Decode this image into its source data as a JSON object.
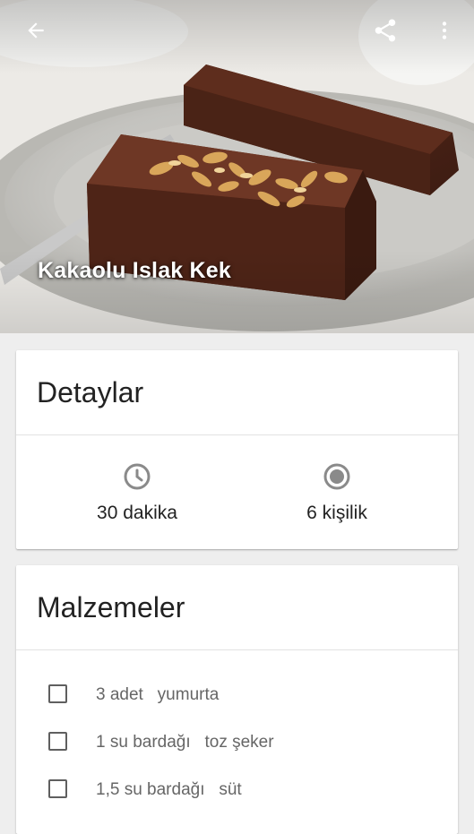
{
  "hero": {
    "title": "Kakaolu Islak Kek"
  },
  "appbar": {
    "icons": [
      "arrow-back-icon",
      "share-icon",
      "more-vert-icon"
    ]
  },
  "details": {
    "title": "Detaylar",
    "time": "30 dakika",
    "servings": "6 kişilik",
    "icons": [
      "clock-icon",
      "servings-icon"
    ]
  },
  "ingredients": {
    "title": "Malzemeler",
    "items": [
      {
        "amount": "3 adet",
        "name": "yumurta",
        "checked": false
      },
      {
        "amount": "1 su bardağı",
        "name": "toz şeker",
        "checked": false
      },
      {
        "amount": "1,5 su bardağı",
        "name": "süt",
        "checked": false
      }
    ]
  },
  "colors": {
    "background": "#eeeeee",
    "card": "#ffffff",
    "icon_gray": "#8a8a8a",
    "cake_brown": "#5a2e1f"
  }
}
